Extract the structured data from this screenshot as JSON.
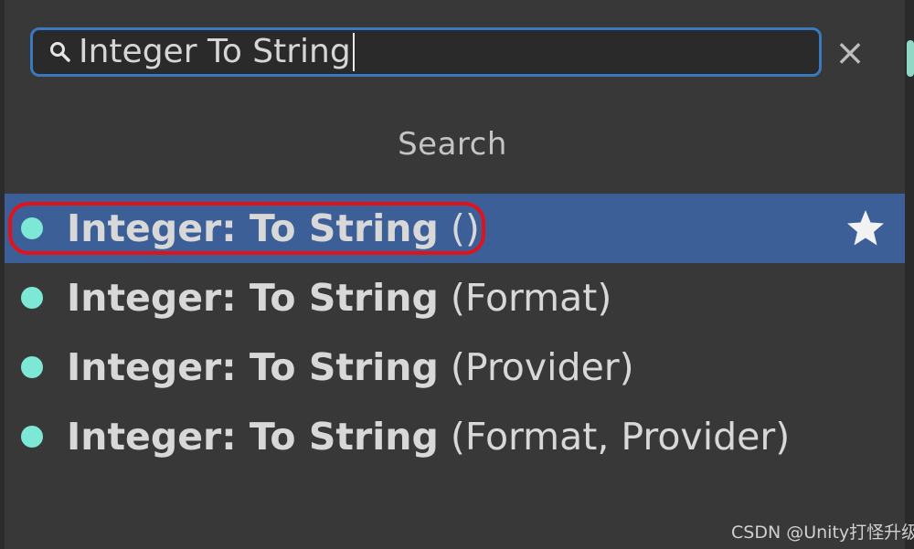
{
  "search": {
    "value": "Integer To String",
    "clear_label": "×"
  },
  "section_header": "Search",
  "results": [
    {
      "name": "Integer: To String",
      "params": "()",
      "selected": true,
      "favorite": true
    },
    {
      "name": "Integer: To String",
      "params": "(Format)",
      "selected": false,
      "favorite": false
    },
    {
      "name": "Integer: To String",
      "params": "(Provider)",
      "selected": false,
      "favorite": false
    },
    {
      "name": "Integer: To String",
      "params": "(Format, Provider)",
      "selected": false,
      "favorite": false
    }
  ],
  "icons": {
    "search": "search-icon",
    "clear": "close-icon",
    "bullet": "node-dot-icon",
    "favorite": "star-icon"
  },
  "colors": {
    "background": "#383838",
    "selection": "#3d5f98",
    "focus_border": "#3a79bf",
    "bullet": "#7ee8d6",
    "highlight_ring": "#e2121b"
  },
  "watermark": "CSDN @Unity打怪升级"
}
